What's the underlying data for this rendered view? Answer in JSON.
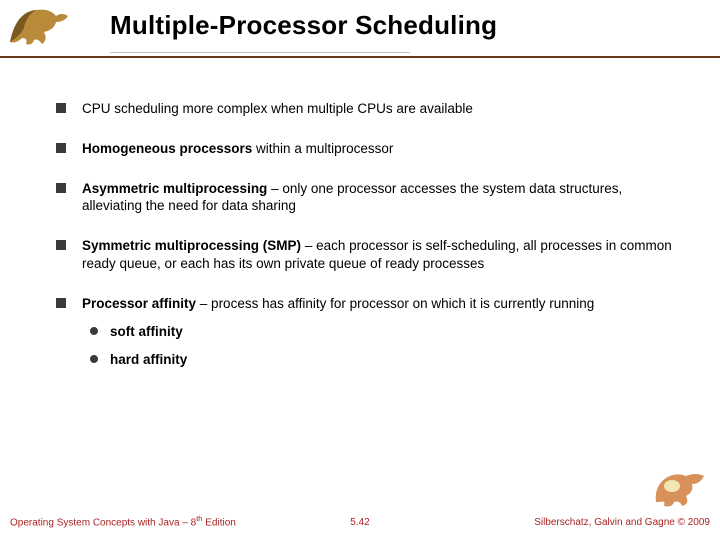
{
  "header": {
    "title": "Multiple-Processor Scheduling"
  },
  "bullets": {
    "b0": {
      "text": "CPU scheduling more complex when multiple CPUs are available"
    },
    "b1": {
      "bold": "Homogeneous processors",
      "rest": " within a multiprocessor"
    },
    "b2": {
      "bold": "Asymmetric multiprocessing",
      "rest": " – only one processor accesses the system data structures, alleviating the need for data sharing"
    },
    "b3": {
      "bold": "Symmetric multiprocessing  (SMP)",
      "rest": " – each processor is self-scheduling, all processes in common ready queue, or each has its own private queue of ready processes"
    },
    "b4": {
      "bold": "Processor affinity",
      "rest": " – process has affinity for processor on which it is currently running",
      "sub0": "soft affinity",
      "sub1": "hard affinity"
    }
  },
  "footer": {
    "left_a": "Operating System Concepts with Java – 8",
    "left_b": "th",
    "left_c": " Edition",
    "center": "5.42",
    "right": "Silberschatz, Galvin and Gagne © 2009"
  }
}
